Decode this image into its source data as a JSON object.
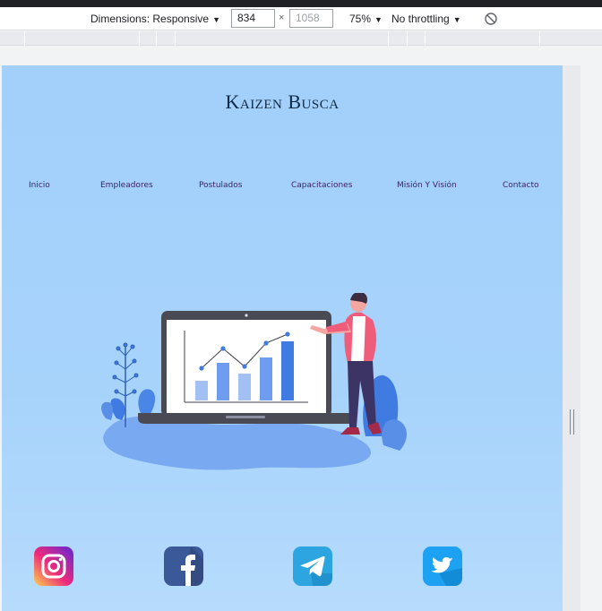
{
  "devtools": {
    "dimensions_label": "Dimensions: Responsive",
    "width_value": "834",
    "height_value": "1058",
    "zoom_label": "75%",
    "throttling_label": "No throttling"
  },
  "site": {
    "title": "Kaizen Busca",
    "nav": [
      "Inicio",
      "Empleadores",
      "Postulados",
      "Capacitaciones",
      "Misión Y Visión",
      "Contacto"
    ]
  },
  "social": [
    {
      "icon": "instagram-icon",
      "color": "#e1306c"
    },
    {
      "icon": "facebook-icon",
      "color": "#3b5998"
    },
    {
      "icon": "telegram-icon",
      "color": "#2ca5e0"
    },
    {
      "icon": "twitter-icon",
      "color": "#1da1f2"
    }
  ]
}
